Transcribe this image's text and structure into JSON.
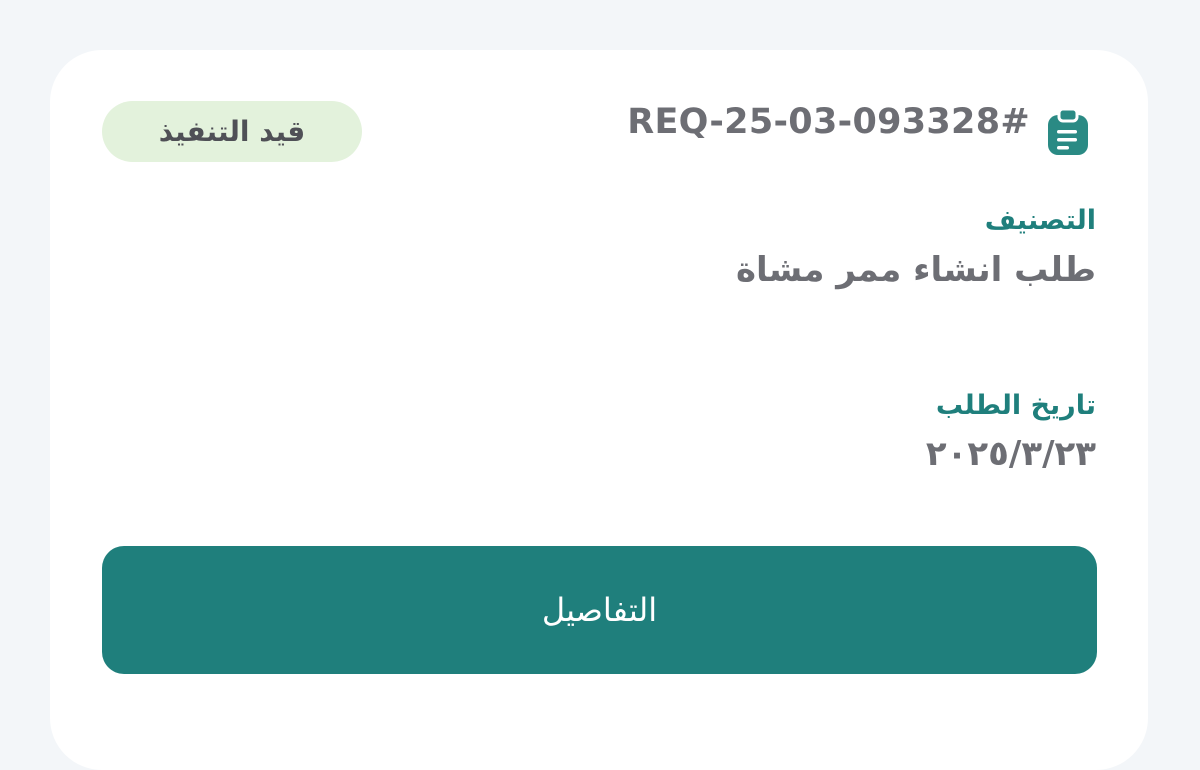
{
  "request": {
    "id": "REQ-25-03-093328#",
    "status": "قيد التنفيذ",
    "icon": "clipboard-icon"
  },
  "category": {
    "label": "التصنيف",
    "value": "طلب انشاء ممر مشاة"
  },
  "request_date": {
    "label": "تاريخ الطلب",
    "value": "٢٠٢٥/٣/٢٣"
  },
  "actions": {
    "details_label": "التفاصيل"
  },
  "colors": {
    "accent": "#1f7f7c",
    "badge_background": "#e3f2dc",
    "text_muted": "#6d6e74",
    "background": "#f3f6f9"
  }
}
